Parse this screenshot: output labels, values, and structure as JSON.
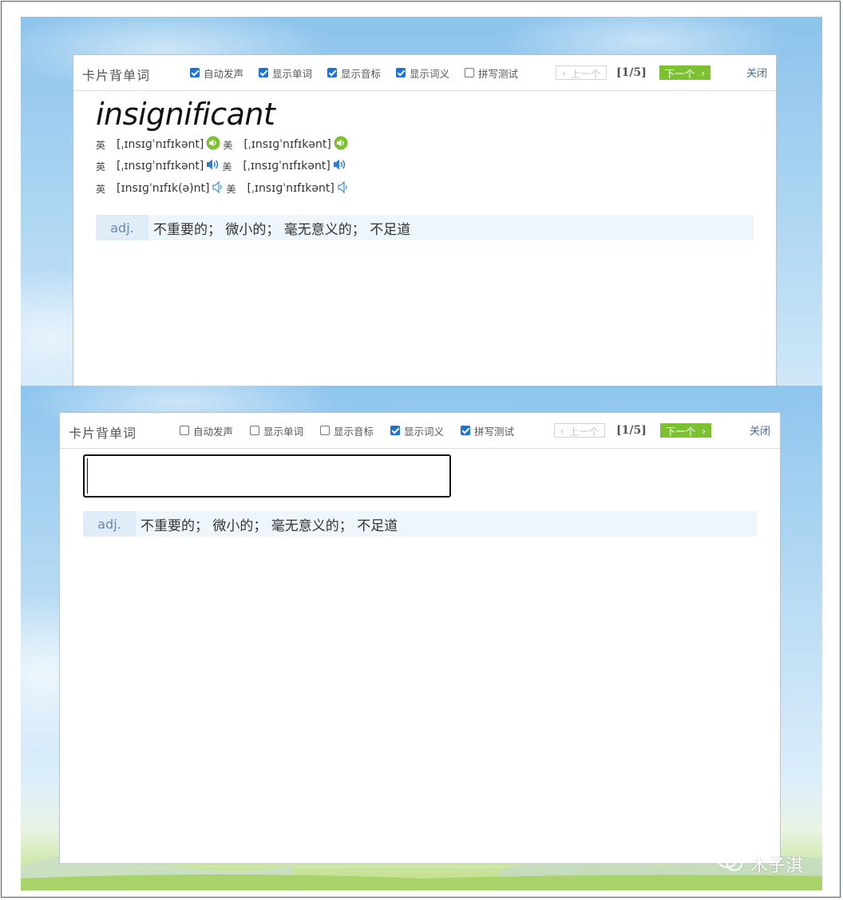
{
  "top_card": {
    "title": "卡片背单词",
    "options": [
      {
        "label": "自动发声",
        "checked": true
      },
      {
        "label": "显示单词",
        "checked": true
      },
      {
        "label": "显示音标",
        "checked": true
      },
      {
        "label": "显示词义",
        "checked": true
      },
      {
        "label": "拼写测试",
        "checked": false
      }
    ],
    "prev_label": "上一个",
    "counter": "[1/5]",
    "next_label": "下一个",
    "close_label": "关闭",
    "word": "insignificant",
    "phonetics": [
      {
        "uk_label": "英",
        "uk": "[ˌɪnsɪɡˈnɪfɪkənt]",
        "us_label": "美",
        "us": "[ˌɪnsɪɡˈnɪfɪkənt]",
        "icon": "green-speaker-icon"
      },
      {
        "uk_label": "英",
        "uk": "[ˌɪnsɪɡˈnɪfɪkənt]",
        "us_label": "美",
        "us": "[ˌɪnsɪɡˈnɪfɪkənt]",
        "icon": "blue-speaker-icon"
      },
      {
        "uk_label": "英",
        "uk": "[ɪnsɪɡˈnɪfɪk(ə)nt]",
        "us_label": "美",
        "us": "[ˌɪnsɪɡˈnɪfɪkənt]",
        "icon": "outline-speaker-icon"
      }
    ],
    "definition": {
      "pos": "adj.",
      "text": "不重要的；  微小的；  毫无意义的；  不足道"
    }
  },
  "bottom_card": {
    "title": "卡片背单词",
    "options": [
      {
        "label": "自动发声",
        "checked": false
      },
      {
        "label": "显示单词",
        "checked": false
      },
      {
        "label": "显示音标",
        "checked": false
      },
      {
        "label": "显示词义",
        "checked": true
      },
      {
        "label": "拼写测试",
        "checked": true
      }
    ],
    "prev_label": "上一个",
    "counter": "[1/5]",
    "next_label": "下一个",
    "close_label": "关闭",
    "spelling_input": {
      "value": "",
      "placeholder": ""
    },
    "definition": {
      "pos": "adj.",
      "text": "不重要的；  微小的；  毫无意义的；  不足道"
    }
  },
  "watermark": {
    "text": "木子淇",
    "icon": "wechat-icon"
  },
  "colors": {
    "accent_green": "#7cc132",
    "link_blue": "#2f6fb3",
    "checkbox_blue": "#1a73d9"
  }
}
